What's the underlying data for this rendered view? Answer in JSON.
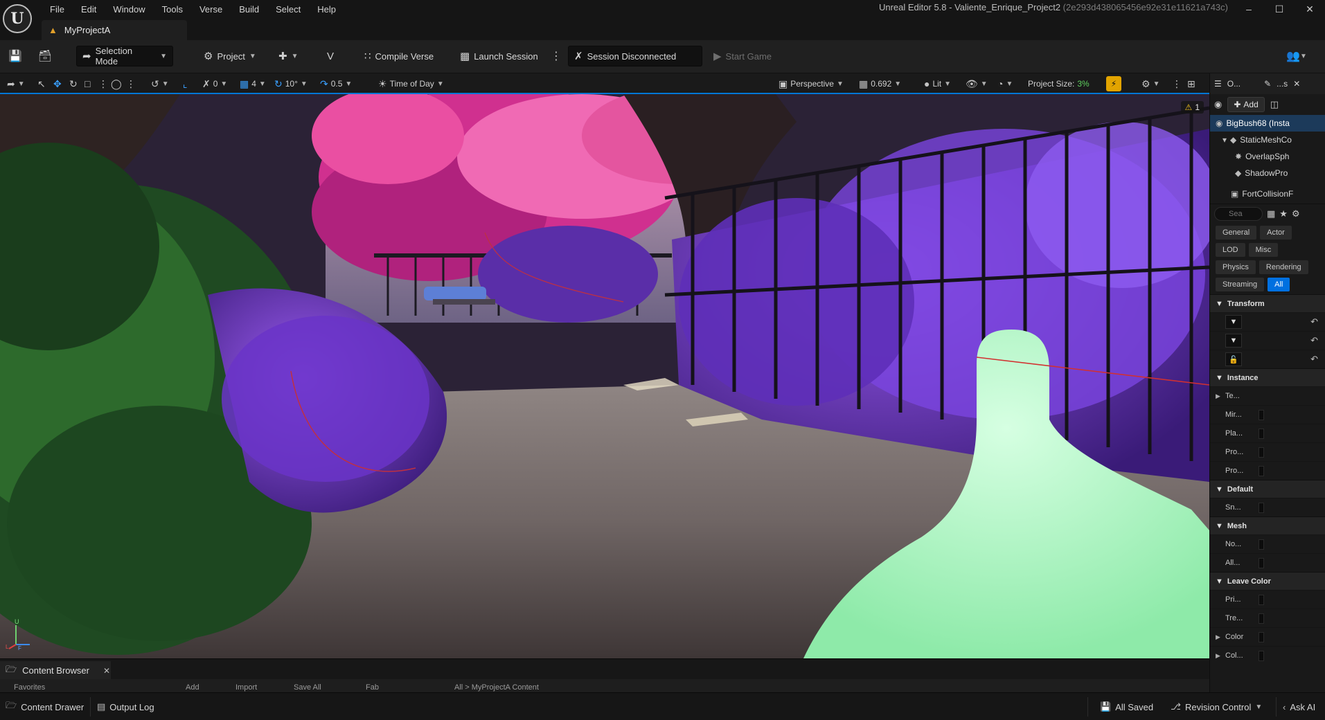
{
  "app": {
    "logo_text": "U",
    "window_title": "Unreal Editor 5.8 - Valiente_Enrique_Project2",
    "window_hash": "(2e293d438065456e92e31e11621a743c)"
  },
  "menu": [
    "File",
    "Edit",
    "Window",
    "Tools",
    "Verse",
    "Build",
    "Select",
    "Help"
  ],
  "project_tab": {
    "label": "MyProjectA"
  },
  "toolbar": {
    "selection_mode": "Selection Mode",
    "project": "Project",
    "compile_verse": "Compile Verse",
    "launch_session": "Launch Session",
    "session_status": "Session Disconnected",
    "start_game": "Start Game"
  },
  "viewport_toolbar": {
    "rotation_snap": "0",
    "grid_snap": "4",
    "angle_snap": "10°",
    "scale_snap": "0.5",
    "time_of_day": "Time of Day",
    "view_mode": "Perspective",
    "fov_scale": "0.692",
    "lit": "Lit",
    "project_size_label": "Project Size:",
    "project_size_value": "3%"
  },
  "viewport": {
    "warning_count": "1",
    "axis_up": "U",
    "axis_left": "L",
    "axis_forward": "F"
  },
  "outliner": {
    "tab_outliner": "O...",
    "tab_details": "...s",
    "add_label": "Add",
    "items": [
      {
        "label": "BigBush68 (Insta",
        "selected": true
      },
      {
        "label": "StaticMeshCo"
      },
      {
        "label": "OverlapSph"
      },
      {
        "label": "ShadowPro"
      },
      {
        "label": "FortCollisionF"
      }
    ]
  },
  "details": {
    "search_placeholder": "Sea",
    "filters": [
      "General",
      "Actor",
      "LOD",
      "Misc",
      "Physics",
      "Rendering",
      "Streaming",
      "All"
    ],
    "active_filter": "All",
    "sections": {
      "transform": "Transform",
      "instance": "Instance",
      "default": "Default",
      "mesh": "Mesh",
      "leave_color": "Leave Color"
    },
    "instance_rows": [
      "Te...",
      "Mir...",
      "Pla...",
      "Pro...",
      "Pro..."
    ],
    "default_rows": [
      "Sn..."
    ],
    "mesh_rows": [
      "No...",
      "All..."
    ],
    "leave_color_rows": [
      "Pri...",
      "Tre...",
      "Color",
      "Col..."
    ]
  },
  "content_browser": {
    "tab_label": "Content Browser",
    "peek_add": "Add",
    "peek_import": "Import",
    "peek_save": "Save All",
    "peek_fab": "Fab",
    "peek_path": "All  >  MyProjectA Content",
    "peek_fav": "Favorites"
  },
  "statusbar": {
    "content_drawer": "Content Drawer",
    "output_log": "Output Log",
    "all_saved": "All Saved",
    "revision_control": "Revision Control",
    "ask_ai": "Ask AI"
  },
  "colors": {
    "accent_blue": "#0077d6",
    "project_size_green": "#5fd05f",
    "warning_yellow": "#f2c21b",
    "foliage_purple": "#7a3fd0",
    "blossom_pink": "#e0409a",
    "ghost_green": "#a8f5c0"
  }
}
